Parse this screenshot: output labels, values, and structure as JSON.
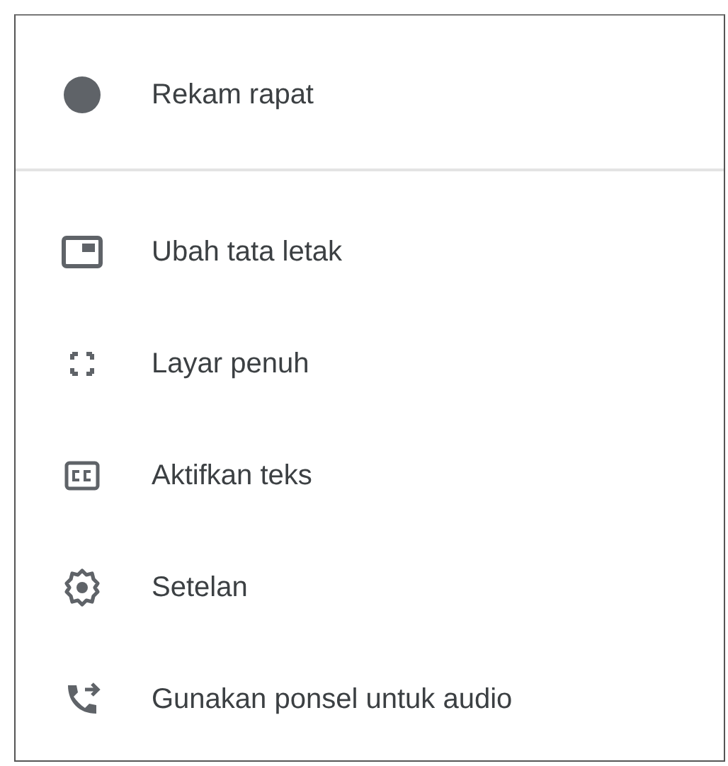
{
  "menu": {
    "sections": [
      {
        "items": [
          {
            "label": "Rekam rapat"
          }
        ]
      },
      {
        "items": [
          {
            "label": "Ubah tata letak"
          },
          {
            "label": "Layar penuh"
          },
          {
            "label": "Aktifkan teks"
          },
          {
            "label": "Setelan"
          },
          {
            "label": "Gunakan ponsel untuk audio"
          }
        ]
      }
    ]
  }
}
